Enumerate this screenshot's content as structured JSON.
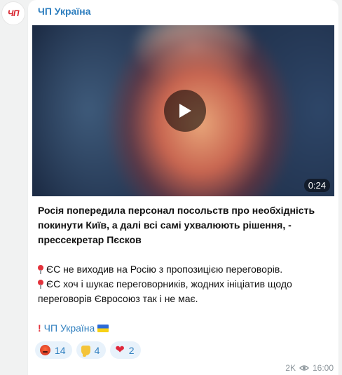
{
  "channel": {
    "avatar_text": "ЧП",
    "name": "ЧП Україна"
  },
  "video": {
    "duration": "0:24"
  },
  "post": {
    "headline_1": "Росія попередила персонал посольств про необхідність",
    "headline_2": "покинути Київ, а далі всі самі ухвалюють рішення, -",
    "headline_3": "прессекретар Пєсков",
    "point_1": "ЄС не виходив на Росію з пропозицією переговорів.",
    "point_2a": "ЄС хоч і шукає переговорників, жодних ініціатив щодо",
    "point_2b": "переговорів Євросоюз так і не має.",
    "signature": "ЧП Україна"
  },
  "reactions": [
    {
      "icon": "angry-face",
      "count": "14"
    },
    {
      "icon": "thumbs-down",
      "count": "4"
    },
    {
      "icon": "red-heart",
      "count": "2"
    }
  ],
  "meta": {
    "views": "2K",
    "time": "16:00"
  },
  "colors": {
    "link": "#2f7fbf",
    "background": "#f1f2f2",
    "bubble": "#ffffff",
    "reaction_bg": "#e8f2fb"
  }
}
